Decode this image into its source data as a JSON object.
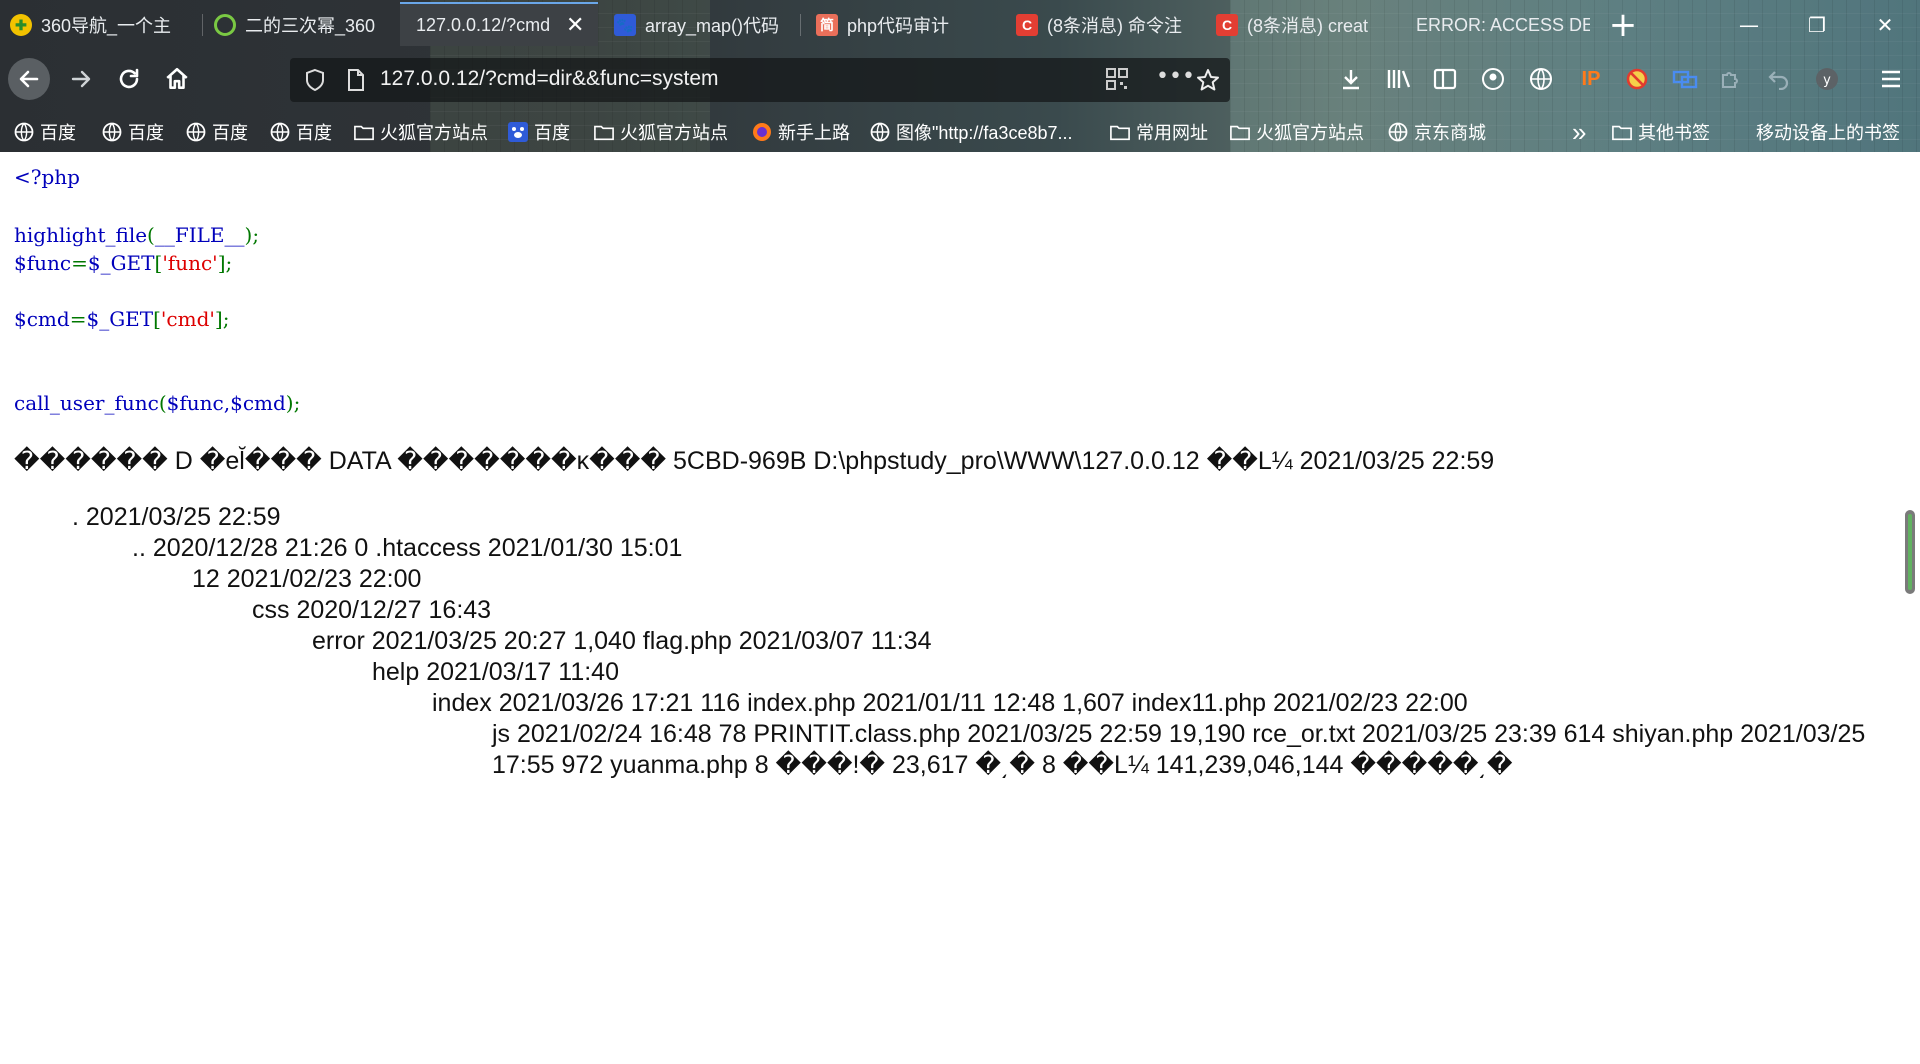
{
  "tabs": [
    {
      "label": "360导航_一个主",
      "icon": "360-logo-icon"
    },
    {
      "label": "二的三次幂_360",
      "icon": "360-search-icon"
    },
    {
      "label": "127.0.0.12/?cmd",
      "icon": "",
      "active": true
    },
    {
      "label": "array_map()代码",
      "icon": "baidu-paw-icon"
    },
    {
      "label": "php代码审计 ",
      "icon": "jianshu-icon"
    },
    {
      "label": "(8条消息) 命令注",
      "icon": "csdn-icon"
    },
    {
      "label": "(8条消息) creat",
      "icon": "csdn-icon"
    },
    {
      "label": "ERROR: ACCESS DE",
      "icon": ""
    }
  ],
  "tab_close_symbol": "✕",
  "new_tab_symbol": "+",
  "window": {
    "minimize": "—",
    "maximize": "❐",
    "close": "✕"
  },
  "url": "127.0.0.12/?cmd=dir&&func=system",
  "bookmarks": [
    {
      "label": "百度",
      "icon": "globe-icon"
    },
    {
      "label": "百度",
      "icon": "globe-icon"
    },
    {
      "label": "百度",
      "icon": "globe-icon"
    },
    {
      "label": "百度",
      "icon": "globe-icon"
    },
    {
      "label": "火狐官方站点",
      "icon": "folder-icon"
    },
    {
      "label": "百度",
      "icon": "baidu-paw-icon"
    },
    {
      "label": "火狐官方站点",
      "icon": "folder-icon"
    },
    {
      "label": "新手上路",
      "icon": "firefox-icon"
    },
    {
      "label": "图像\"http://fa3ce8b7...",
      "icon": "globe-icon"
    },
    {
      "label": "常用网址",
      "icon": "folder-icon"
    },
    {
      "label": "火狐官方站点",
      "icon": "folder-icon"
    },
    {
      "label": "京东商城",
      "icon": "globe-icon"
    }
  ],
  "bookmarks_overflow": "»",
  "other_bookmarks": "其他书签",
  "mobile_bookmarks": "移动设备上的书签",
  "code": {
    "open_tag": "<?php",
    "line1_fn": "highlight_file",
    "line1_paren_open": "(",
    "line1_arg": "__FILE__",
    "line1_close": ");",
    "line2_var": "$func",
    "line2_eq": "=",
    "line2_get": "$_GET",
    "line2_bo": "[",
    "line2_key": "'func'",
    "line2_bc": "];",
    "line3_var": "$cmd",
    "line3_eq": "=",
    "line3_get": "$_GET",
    "line3_bo": "[",
    "line3_key": "'cmd'",
    "line3_bc": "];",
    "line4_fn": "call_user_func",
    "line4_po": "(",
    "line4_args": "$func,$cmd",
    "line4_pc": ");"
  },
  "output": [
    "������ D �el̆��� DATA �������ĸ��� 5CBD-969B D:\\phpstudy_pro\\WWW\\127.0.0.12 ��L¼ 2021/03/25 22:59",
    ". 2021/03/25 22:59",
    ".. 2020/12/28 21:26 0 .htaccess 2021/01/30 15:01",
    "12 2021/02/23 22:00",
    "css 2020/12/27 16:43",
    "error 2021/03/25 20:27 1,040 flag.php 2021/03/07 11:34",
    "help 2021/03/17 11:40",
    "index 2021/03/26 17:21 116 index.php 2021/01/11 12:48 1,607 index11.php 2021/02/23 22:00",
    "js 2021/02/24 16:48 78 PRINTIT.class.php 2021/03/25 22:59 19,190 rce_or.txt 2021/03/25 23:39 614 shiyan.php 2021/03/25",
    "17:55 972 yuanma.php 8 ���!� 23,617 �͵� 8 ��L¼ 141,239,046,144 �����͵�"
  ],
  "colors": {
    "php_default": "#0000bb",
    "php_keyword": "#007700",
    "php_string": "#dd0000",
    "active_tab_indicator": "#6aa6e8"
  }
}
